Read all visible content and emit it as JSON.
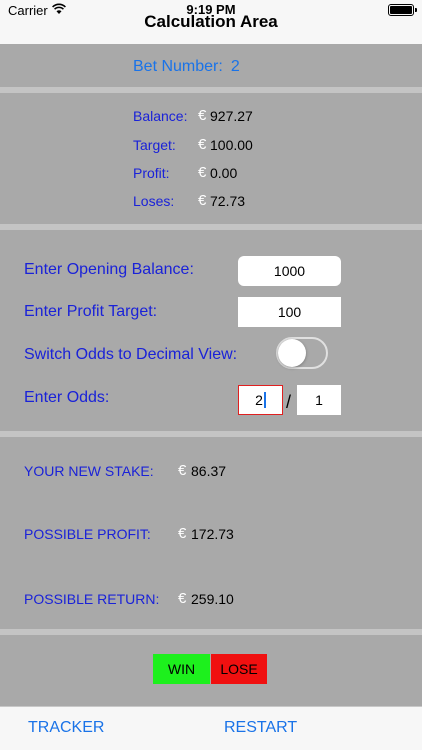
{
  "status": {
    "carrier": "Carrier",
    "time": "9:19 PM"
  },
  "nav": {
    "title": "Calculation Area"
  },
  "bet": {
    "label": "Bet Number:",
    "value": "2"
  },
  "stats": [
    {
      "label": "Balance:",
      "currency": "€",
      "value": "927.27"
    },
    {
      "label": "Target:",
      "currency": "€",
      "value": "100.00"
    },
    {
      "label": "Profit:",
      "currency": "€",
      "value": "0.00"
    },
    {
      "label": "Loses:",
      "currency": "€",
      "value": "72.73"
    }
  ],
  "inputs": {
    "opening_balance": {
      "label": "Enter Opening Balance:",
      "value": "1000"
    },
    "profit_target": {
      "label": "Enter Profit Target:",
      "value": "100"
    },
    "decimal_view": {
      "label": "Switch Odds to Decimal View:",
      "on": false
    },
    "odds": {
      "label": "Enter Odds:",
      "numerator": "2",
      "separator": "/",
      "denominator": "1"
    }
  },
  "results": [
    {
      "label": "YOUR NEW STAKE:",
      "currency": "€",
      "value": "86.37"
    },
    {
      "label": "POSSIBLE PROFIT:",
      "currency": "€",
      "value": "172.73"
    },
    {
      "label": "POSSIBLE RETURN:",
      "currency": "€",
      "value": "259.10"
    }
  ],
  "actions": {
    "win": "WIN",
    "lose": "LOSE"
  },
  "tabbar": {
    "tracker": "TRACKER",
    "restart": "RESTART"
  },
  "colors": {
    "background": "#a9a9a9",
    "separator": "#c4c4c4",
    "label_blue": "#1a22d8",
    "link_blue": "#1a73e8",
    "win": "#1df01d",
    "lose": "#f01010"
  }
}
